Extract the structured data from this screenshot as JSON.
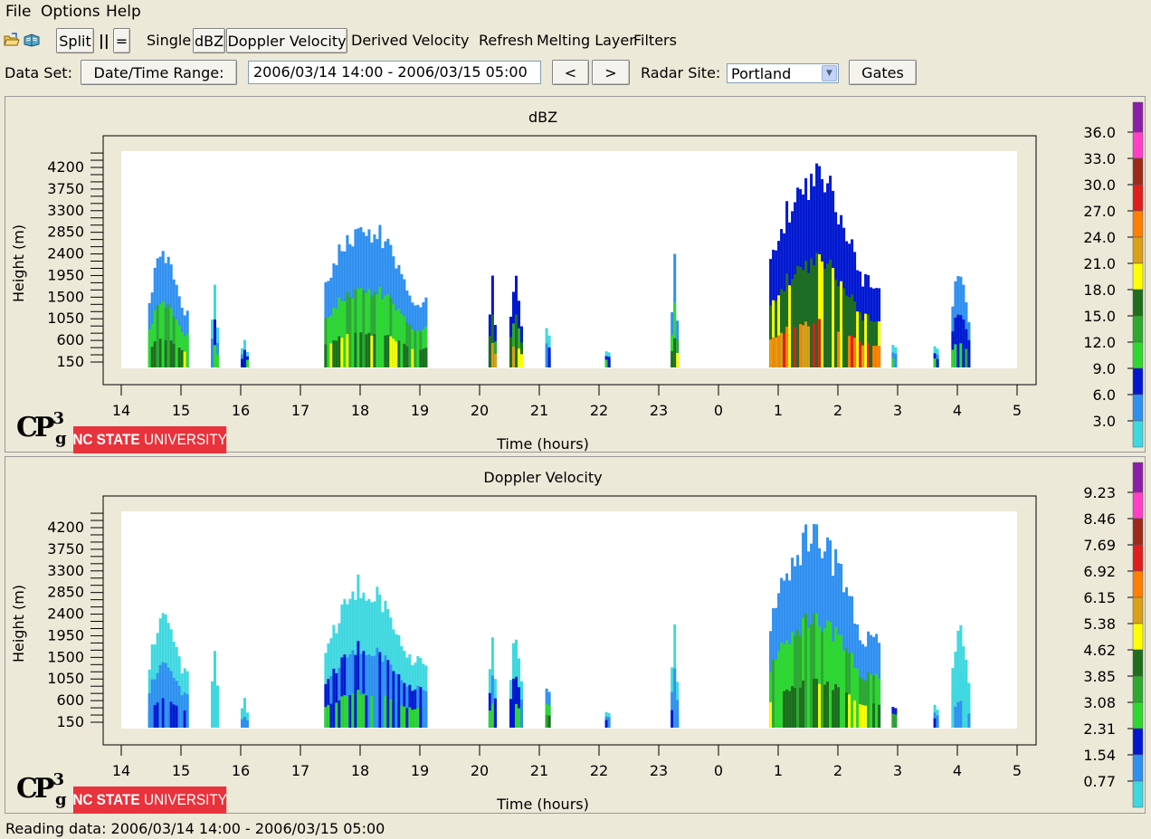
{
  "menu": [
    "File",
    "Options",
    "Help"
  ],
  "toolbar": {
    "split": "Split",
    "parallel": "||",
    "equals": "=",
    "single": "Single",
    "dbz": "dBZ",
    "doppler": "Doppler Velocity",
    "derived": "Derived Velocity",
    "refresh": "Refresh",
    "melting": "Melting Layer",
    "filters": "Filters",
    "icons": [
      "open-folder-icon",
      "open-book-icon"
    ]
  },
  "dataset": {
    "label": "Data Set:",
    "range_button": "Date/Time Range:",
    "range_value": "2006/03/14 14:00 - 2006/03/15 05:00",
    "prev": "<",
    "next": ">",
    "site_label": "Radar Site:",
    "site_value": "Portland",
    "gates": "Gates"
  },
  "logos": {
    "cp": "CP",
    "cp_sup": "3",
    "cp_sub": "g",
    "university_bold": "NC STATE",
    "university_rest": "UNIVERSITY"
  },
  "status": "Reading data: 2006/03/14 14:00 - 2006/03/15 05:00",
  "chart_data": [
    {
      "type": "heatmap",
      "title": "dBZ",
      "xlabel": "Time (hours)",
      "ylabel": "Height (m)",
      "x_ticks": [
        "14",
        "15",
        "16",
        "17",
        "18",
        "19",
        "20",
        "21",
        "22",
        "23",
        "0",
        "1",
        "2",
        "3",
        "4",
        "5"
      ],
      "y_ticks": [
        150,
        600,
        1050,
        1500,
        1950,
        2400,
        2850,
        3300,
        3750,
        4200
      ],
      "colorbar_labels": [
        "36.0",
        "33.0",
        "30.0",
        "27.0",
        "24.0",
        "21.0",
        "18.0",
        "15.0",
        "12.0",
        "9.0",
        "6.0",
        "3.0"
      ],
      "colorbar_colors": [
        "#8b1fa8",
        "#ff3fc8",
        "#9b2a1a",
        "#e01e1e",
        "#ff8000",
        "#d9a018",
        "#ffff00",
        "#1e6e1e",
        "#2ea82e",
        "#2ed82e",
        "#0018d0",
        "#3090f0",
        "#40d8e0"
      ],
      "echoes": [
        {
          "start": 14.45,
          "end": 15.1,
          "top": 2700,
          "peak": 21
        },
        {
          "start": 15.5,
          "end": 15.6,
          "top": 2000,
          "peak": 12
        },
        {
          "start": 16.0,
          "end": 16.1,
          "top": 700,
          "peak": 12
        },
        {
          "start": 17.4,
          "end": 19.1,
          "top": 3300,
          "peak": 21
        },
        {
          "start": 20.15,
          "end": 20.25,
          "top": 2250,
          "peak": 27
        },
        {
          "start": 20.5,
          "end": 20.7,
          "top": 2150,
          "peak": 27
        },
        {
          "start": 21.1,
          "end": 21.15,
          "top": 1600,
          "peak": 12
        },
        {
          "start": 22.1,
          "end": 22.15,
          "top": 600,
          "peak": 12
        },
        {
          "start": 23.2,
          "end": 23.3,
          "top": 2450,
          "peak": 21
        },
        {
          "start": 24.85,
          "end": 26.7,
          "top": 4400,
          "peak": 30
        },
        {
          "start": 26.9,
          "end": 26.95,
          "top": 850,
          "peak": 12
        },
        {
          "start": 27.6,
          "end": 27.65,
          "top": 850,
          "peak": 12
        },
        {
          "start": 27.9,
          "end": 28.2,
          "top": 2400,
          "peak": 15
        }
      ]
    },
    {
      "type": "heatmap",
      "title": "Doppler Velocity",
      "xlabel": "Time (hours)",
      "ylabel": "Height (m)",
      "x_ticks": [
        "14",
        "15",
        "16",
        "17",
        "18",
        "19",
        "20",
        "21",
        "22",
        "23",
        "0",
        "1",
        "2",
        "3",
        "4",
        "5"
      ],
      "y_ticks": [
        150,
        600,
        1050,
        1500,
        1950,
        2400,
        2850,
        3300,
        3750,
        4200
      ],
      "colorbar_labels": [
        "9.23",
        "8.46",
        "7.69",
        "6.92",
        "6.15",
        "5.38",
        "4.62",
        "3.85",
        "3.08",
        "2.31",
        "1.54",
        "0.77"
      ],
      "colorbar_colors": [
        "#8b1fa8",
        "#ff3fc8",
        "#9b2a1a",
        "#e01e1e",
        "#ff8000",
        "#d9a018",
        "#ffff00",
        "#1e6e1e",
        "#2ea82e",
        "#2ed82e",
        "#0018d0",
        "#3090f0",
        "#40d8e0"
      ],
      "echoes": [
        {
          "start": 14.45,
          "end": 15.1,
          "top": 2700,
          "peak": 2.31
        },
        {
          "start": 15.5,
          "end": 15.6,
          "top": 2000,
          "peak": 0.77
        },
        {
          "start": 16.0,
          "end": 16.1,
          "top": 700,
          "peak": 1.54
        },
        {
          "start": 17.4,
          "end": 19.1,
          "top": 3300,
          "peak": 3.08
        },
        {
          "start": 20.15,
          "end": 20.25,
          "top": 2250,
          "peak": 3.08
        },
        {
          "start": 20.5,
          "end": 20.7,
          "top": 2150,
          "peak": 3.08
        },
        {
          "start": 21.1,
          "end": 21.15,
          "top": 1600,
          "peak": 4.62
        },
        {
          "start": 22.1,
          "end": 22.15,
          "top": 600,
          "peak": 2.31
        },
        {
          "start": 23.2,
          "end": 23.3,
          "top": 2450,
          "peak": 2.31
        },
        {
          "start": 24.85,
          "end": 26.7,
          "top": 4400,
          "peak": 5.38
        },
        {
          "start": 26.9,
          "end": 26.95,
          "top": 850,
          "peak": 6.15
        },
        {
          "start": 27.6,
          "end": 27.65,
          "top": 850,
          "peak": 2.31
        },
        {
          "start": 27.9,
          "end": 28.2,
          "top": 2400,
          "peak": 1.54
        }
      ]
    }
  ]
}
